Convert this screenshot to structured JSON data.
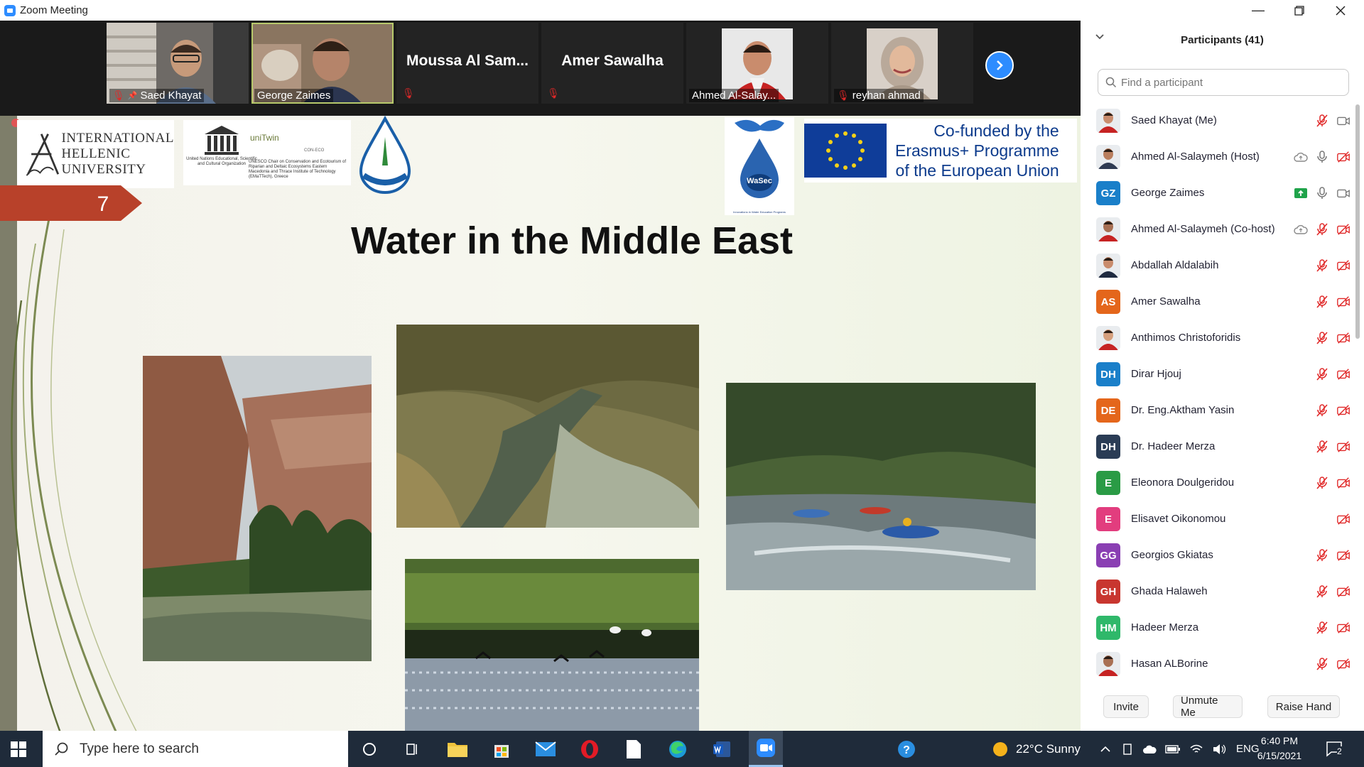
{
  "window": {
    "title": "Zoom Meeting"
  },
  "gallery": {
    "tiles": [
      {
        "name": "Saed Khayat",
        "type": "video"
      },
      {
        "name": "George Zaimes",
        "type": "video"
      },
      {
        "name": "Moussa Al Sam...",
        "type": "name"
      },
      {
        "name": "Amer Sawalha",
        "type": "name"
      },
      {
        "name": "Ahmed Al-Salay...",
        "type": "photo"
      },
      {
        "name": "reyhan ahmad",
        "type": "photo"
      }
    ]
  },
  "slide": {
    "number": "7",
    "title": "Water in the Middle East",
    "ihu_text": "INTERNATIONAL\nHELLENIC\nUNIVERSITY",
    "unesco_text": "United Nations Educational, Scientific and Cultural Organization",
    "unitwin": "uniTwin",
    "chair_text": "UNESCO Chair on Conservation and Ecotourism of Riparian and Deltaic Ecosystems Eastern Macedonia and Thrace Institute of Technology (EMaTTech), Greece",
    "cgp": "CON-ECO",
    "wasec_label": "WaSec",
    "wasec_caption": "Innovations in Water Education Programs",
    "cofunded": "Co-funded by the\nErasmus+ Programme\nof the European Union"
  },
  "participants": {
    "title": "Participants (41)",
    "search_placeholder": "Find a participant",
    "list": [
      {
        "name": "Saed Khayat (Me)",
        "avatar": "photo",
        "color": "#ffffff",
        "status": [
          "mic-off",
          "video-on"
        ]
      },
      {
        "name": "Ahmed Al-Salaymeh (Host)",
        "avatar": "photo",
        "color": "#ffffff",
        "status": [
          "cloud",
          "mic-on",
          "video-off"
        ]
      },
      {
        "name": "George Zaimes",
        "initials": "GZ",
        "color": "#1a7fc9",
        "status": [
          "share",
          "mic-on",
          "video-on"
        ]
      },
      {
        "name": "Ahmed Al-Salaymeh (Co-host)",
        "avatar": "photo",
        "color": "#ffffff",
        "status": [
          "cloud",
          "mic-off",
          "video-off"
        ]
      },
      {
        "name": "Abdallah Aldalabih",
        "avatar": "photo",
        "color": "#ffffff",
        "status": [
          "mic-off",
          "video-off"
        ]
      },
      {
        "name": "Amer Sawalha",
        "initials": "AS",
        "color": "#e4661b",
        "status": [
          "mic-off",
          "video-off"
        ]
      },
      {
        "name": "Anthimos Christoforidis",
        "avatar": "photo",
        "color": "#ffffff",
        "status": [
          "mic-off",
          "video-off"
        ]
      },
      {
        "name": "Dirar Hjouj",
        "initials": "DH",
        "color": "#1a7fc9",
        "status": [
          "mic-off",
          "video-off"
        ]
      },
      {
        "name": "Dr. Eng.Aktham Yasin",
        "initials": "DE",
        "color": "#e4661b",
        "status": [
          "mic-off",
          "video-off"
        ]
      },
      {
        "name": "Dr. Hadeer Merza",
        "initials": "DH",
        "color": "#2a3c55",
        "status": [
          "mic-off",
          "video-off"
        ]
      },
      {
        "name": "Eleonora Doulgeridou",
        "initials": "E",
        "color": "#2a9b45",
        "status": [
          "mic-off",
          "video-off"
        ]
      },
      {
        "name": "Elisavet Oikonomou",
        "initials": "E",
        "color": "#e23d7e",
        "status": [
          "video-off"
        ]
      },
      {
        "name": "Georgios Gkiatas",
        "initials": "GG",
        "color": "#8a3fb3",
        "status": [
          "mic-off",
          "video-off"
        ]
      },
      {
        "name": "Ghada Halaweh",
        "initials": "GH",
        "color": "#c8362f",
        "status": [
          "mic-off",
          "video-off"
        ]
      },
      {
        "name": "Hadeer Merza",
        "initials": "HM",
        "color": "#2fb86a",
        "status": [
          "mic-off",
          "video-off"
        ]
      },
      {
        "name": "Hasan ALBorine",
        "avatar": "photo",
        "color": "#ffffff",
        "status": [
          "mic-off",
          "video-off"
        ]
      }
    ],
    "buttons": {
      "invite": "Invite",
      "unmute": "Unmute Me",
      "raise_hand": "Raise Hand"
    }
  },
  "taskbar": {
    "search_placeholder": "Type here to search",
    "weather": "22°C  Sunny",
    "language": "ENG",
    "time": "6:40 PM",
    "date": "6/15/2021",
    "notifications": "2"
  },
  "colors": {
    "zoom_blue": "#2d8cff",
    "mute_red": "#e02828",
    "taskbar": "#1f2b3a",
    "slide_banner": "#b8412a"
  }
}
